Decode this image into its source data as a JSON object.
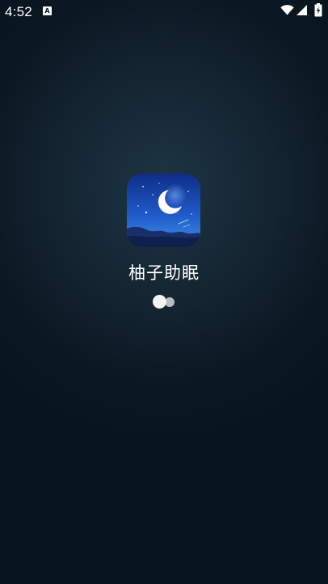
{
  "status_bar": {
    "time": "4:52",
    "notification_badge": "A",
    "icons": [
      "wifi-icon",
      "signal-icon",
      "battery-icon"
    ]
  },
  "splash": {
    "app_name": "柚子助眠",
    "app_icon": "moon-night-app-icon",
    "loading_indicator": "two-dot-loader"
  },
  "colors": {
    "background": "#0b1823",
    "background_glow": "#1e3542",
    "icon_sky_top": "#0e2d86",
    "icon_sky_bottom": "#3f8ee8",
    "text": "#ffffff"
  }
}
